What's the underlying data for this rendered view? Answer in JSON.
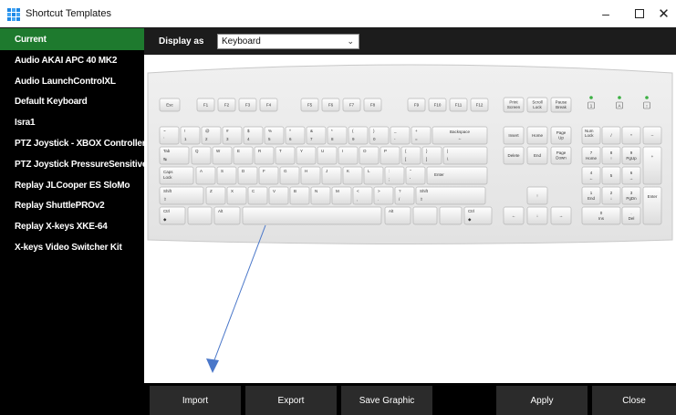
{
  "window": {
    "title": "Shortcut Templates",
    "minimize_glyph": "–",
    "close_glyph": "✕"
  },
  "sidebar": {
    "items": [
      {
        "label": "Current",
        "active": true
      },
      {
        "label": "Audio AKAI APC 40 MK2"
      },
      {
        "label": "Audio LaunchControlXL"
      },
      {
        "label": "Default Keyboard"
      },
      {
        "label": "Isra1"
      },
      {
        "label": "PTZ Joystick - XBOX Controller"
      },
      {
        "label": "PTZ Joystick PressureSensitive"
      },
      {
        "label": "Replay JLCooper ES SloMo"
      },
      {
        "label": "Replay ShuttlePROv2"
      },
      {
        "label": "Replay X-keys XKE-64"
      },
      {
        "label": "X-keys Video Switcher Kit"
      }
    ]
  },
  "header": {
    "display_as_label": "Display as",
    "display_as_value": "Keyboard"
  },
  "keyboard": {
    "esc": "Esc",
    "f1": "F1",
    "f2": "F2",
    "f3": "F3",
    "f4": "F4",
    "f5": "F5",
    "f6": "F6",
    "f7": "F7",
    "f8": "F8",
    "f9": "F9",
    "f10": "F10",
    "f11": "F11",
    "f12": "F12",
    "print_screen_1": "Print",
    "print_screen_2": "Screen",
    "scroll_lock_1": "Scroll",
    "scroll_lock_2": "Lock",
    "pause_break_1": "Pause",
    "pause_break_2": "Break",
    "indicator_1": "1",
    "indicator_a": "A",
    "indicator_scroll": "↕",
    "backspace": "Backspace",
    "tab": "Tab",
    "caps_1": "Caps",
    "caps_2": "Lock",
    "enter": "Enter",
    "shift_l": "Shift",
    "shift_r": "Shift",
    "ctrl_l": "Ctrl",
    "alt_l": "Alt",
    "alt_r": "Alt",
    "ctrl_r": "Ctrl",
    "insert": "Insert",
    "home": "Home",
    "page_up_1": "Page",
    "page_up_2": "Up",
    "delete": "Delete",
    "end": "End",
    "page_down_1": "Page",
    "page_down_2": "Down",
    "num_lock_1": "Num",
    "num_lock_2": "Lock",
    "num_div": "/",
    "num_mul": "*",
    "num_minus": "–",
    "num_plus": "+",
    "num_enter": "Enter",
    "num_0": "0",
    "num_0b": "Ins",
    "num_dot": ".",
    "num_dotb": "Del",
    "num_1": "1",
    "num_1b": "End",
    "num_2": "2",
    "num_3": "3",
    "num_3b": "PgDn",
    "num_4": "4",
    "num_5": "5",
    "num_6": "6",
    "num_7": "7",
    "num_7b": "Home",
    "num_8": "8",
    "num_9": "9",
    "num_9b": "PgUp",
    "row1_top": [
      "~",
      "!",
      "@",
      "#",
      "$",
      "%",
      "^",
      "&",
      "*",
      "(",
      ")",
      "_",
      "+"
    ],
    "row1_bot": [
      "`",
      "1",
      "2",
      "3",
      "4",
      "5",
      "6",
      "7",
      "8",
      "9",
      "0",
      "-",
      "="
    ],
    "row2": [
      "Q",
      "W",
      "E",
      "R",
      "T",
      "Y",
      "U",
      "I",
      "O",
      "P"
    ],
    "row2_top": [
      "{",
      "}",
      "|"
    ],
    "row2_bot": [
      "[",
      "]",
      "\\"
    ],
    "row3": [
      "A",
      "S",
      "D",
      "F",
      "G",
      "H",
      "J",
      "K",
      "L"
    ],
    "row3_top": [
      ":",
      "\""
    ],
    "row3_bot": [
      ";",
      "'"
    ],
    "row4": [
      "Z",
      "X",
      "C",
      "V",
      "B",
      "N",
      "M"
    ],
    "row4_top": [
      "<",
      ">",
      "?"
    ],
    "row4_bot": [
      ",",
      ".",
      "/"
    ],
    "arrows": [
      "↑",
      "←",
      "↓",
      "→"
    ]
  },
  "buttons": {
    "import": "Import",
    "export": "Export",
    "save_graphic": "Save Graphic",
    "apply": "Apply",
    "close": "Close"
  },
  "colors": {
    "active_item": "#1e7a2e",
    "indicator_led": "#3cb043",
    "annotation_arrow": "#4a77c9"
  }
}
